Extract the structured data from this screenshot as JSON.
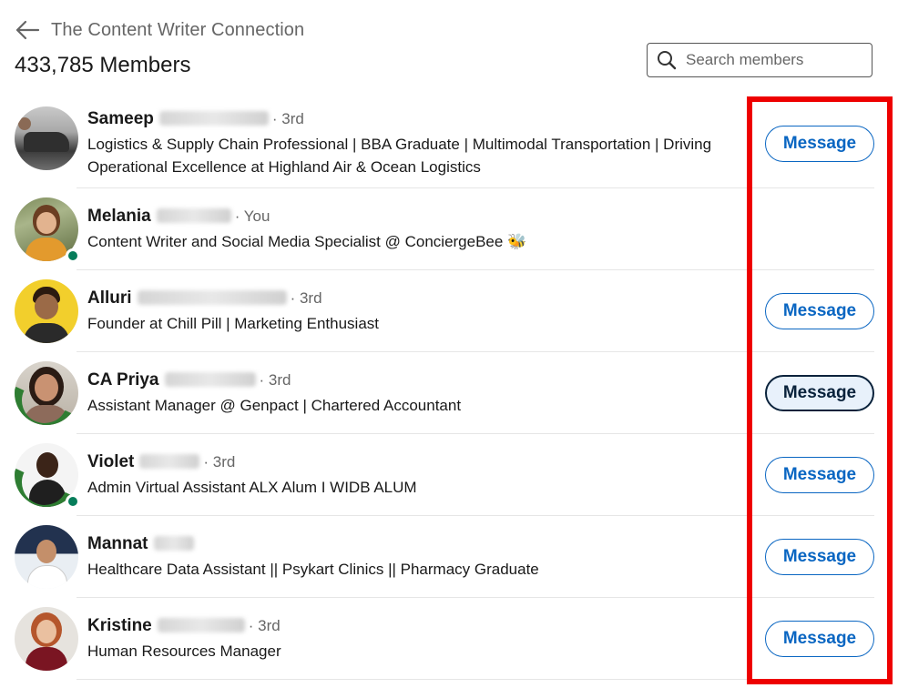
{
  "header": {
    "group_name": "The Content Writer Connection",
    "member_count": "433,785 Members"
  },
  "search": {
    "placeholder": "Search members"
  },
  "members": [
    {
      "first_name": "Sameep",
      "degree": "· 3rd",
      "headline": "Logistics & Supply Chain Professional | BBA Graduate | Multimodal Transportation | Driving Operational Excellence at Highland Air & Ocean Logistics",
      "button": "Message"
    },
    {
      "first_name": "Melania",
      "degree": "· You",
      "headline": "Content Writer and Social Media Specialist @ ConciergeBee 🐝",
      "button": ""
    },
    {
      "first_name": "Alluri",
      "degree": "· 3rd",
      "headline": "Founder at Chill Pill | Marketing Enthusiast",
      "button": "Message"
    },
    {
      "first_name": "CA Priya",
      "degree": "· 3rd",
      "headline": "Assistant Manager @ Genpact | Chartered Accountant",
      "button": "Message"
    },
    {
      "first_name": "Violet",
      "degree": "· 3rd",
      "headline": "Admin Virtual Assistant ALX Alum I WIDB ALUM",
      "button": "Message"
    },
    {
      "first_name": "Mannat",
      "degree": "",
      "headline": "Healthcare Data Assistant || Psykart Clinics || Pharmacy Graduate",
      "button": "Message"
    },
    {
      "first_name": "Kristine",
      "degree": "· 3rd",
      "headline": "Human Resources Manager",
      "button": "Message"
    }
  ],
  "colors": {
    "accent": "#0a66c2",
    "highlight": "#ee0000",
    "presence": "#067d5a"
  }
}
